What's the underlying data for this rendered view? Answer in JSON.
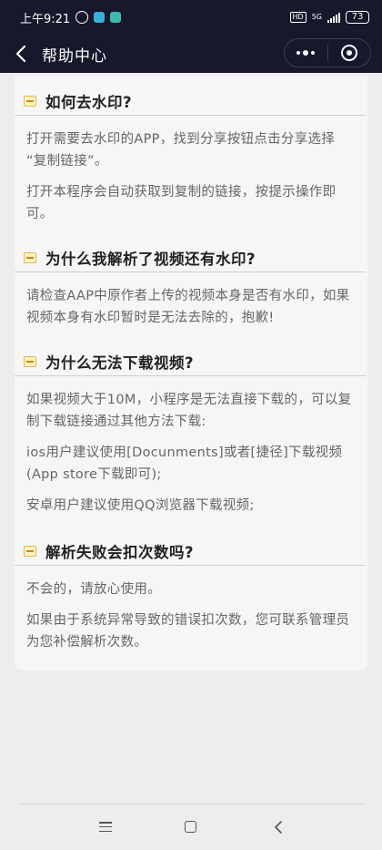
{
  "status_bar": {
    "time": "上午9:21",
    "hd": "HD",
    "network": "5G",
    "battery": "73",
    "app_icon_colors": [
      "#38b0d8",
      "#3fb9b0"
    ]
  },
  "nav": {
    "title": "帮助中心",
    "back_icon": "chevron-left-icon",
    "more_icon": "more-dots-icon",
    "close_icon": "target-circle-icon"
  },
  "faq": [
    {
      "question": "如何去水印?",
      "answers": [
        [
          "打开需要去水印的APP，找到分享按钮点击分享选择",
          "“复制链接”。"
        ],
        [
          "打开本程序会自动获取到复制的链接，按提示操作即",
          "可。"
        ]
      ]
    },
    {
      "question": "为什么我解析了视频还有水印?",
      "answers": [
        [
          "请检查AAP中原作者上传的视频本身是否有水印，如果",
          "视频本身有水印暂时是无法去除的，抱歉!"
        ]
      ]
    },
    {
      "question": "为什么无法下载视频?",
      "answers": [
        [
          "如果视频大于10M，小程序是无法直接下载的，可以复",
          "制下载链接通过其他方法下载:"
        ],
        [
          "ios用户建议使用[Docunments]或者[捷径]下载视频",
          "(App store下载即可);"
        ],
        [
          "安卓用户建议使用QQ浏览器下载视频;"
        ]
      ]
    },
    {
      "question": "解析失败会扣次数吗?",
      "answers": [
        [
          "不会的，请放心使用。"
        ],
        [
          "如果由于系统异常导致的错误扣次数，您可联系管理员",
          "为您补偿解析次数。"
        ]
      ]
    }
  ],
  "system_nav": {
    "menu_icon": "menu-icon",
    "home_icon": "home-square-icon",
    "back_icon": "back-triangle-icon"
  }
}
